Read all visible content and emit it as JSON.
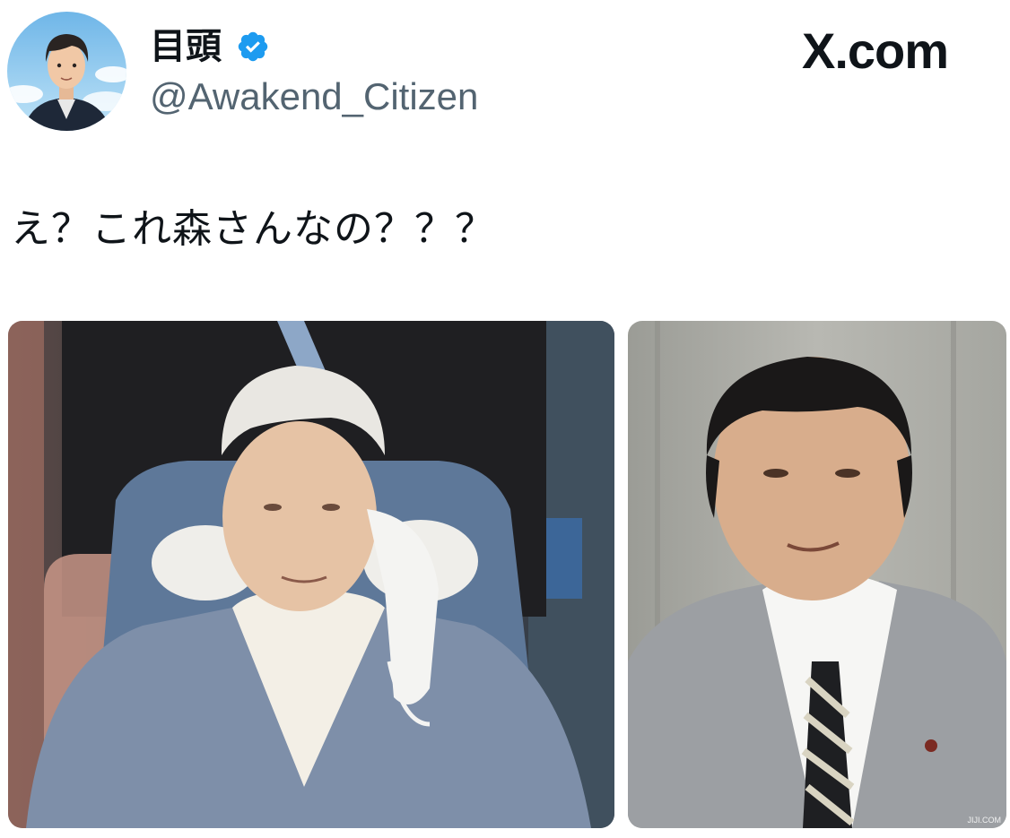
{
  "post": {
    "author": {
      "display_name": "目頭",
      "handle": "@Awakend_Citizen",
      "verified": true,
      "avatar_icon": "illustrated-avatar"
    },
    "brand": "X.com",
    "text": "え？これ森さんなの？？？",
    "media": [
      {
        "icon": "photo-elderly-man-wheelchair"
      },
      {
        "icon": "photo-man-in-suit",
        "watermark": "JIJI.COM"
      }
    ]
  },
  "colors": {
    "verified_badge": "#1d9bf0",
    "handle_text": "#536471",
    "text": "#0f1419"
  }
}
